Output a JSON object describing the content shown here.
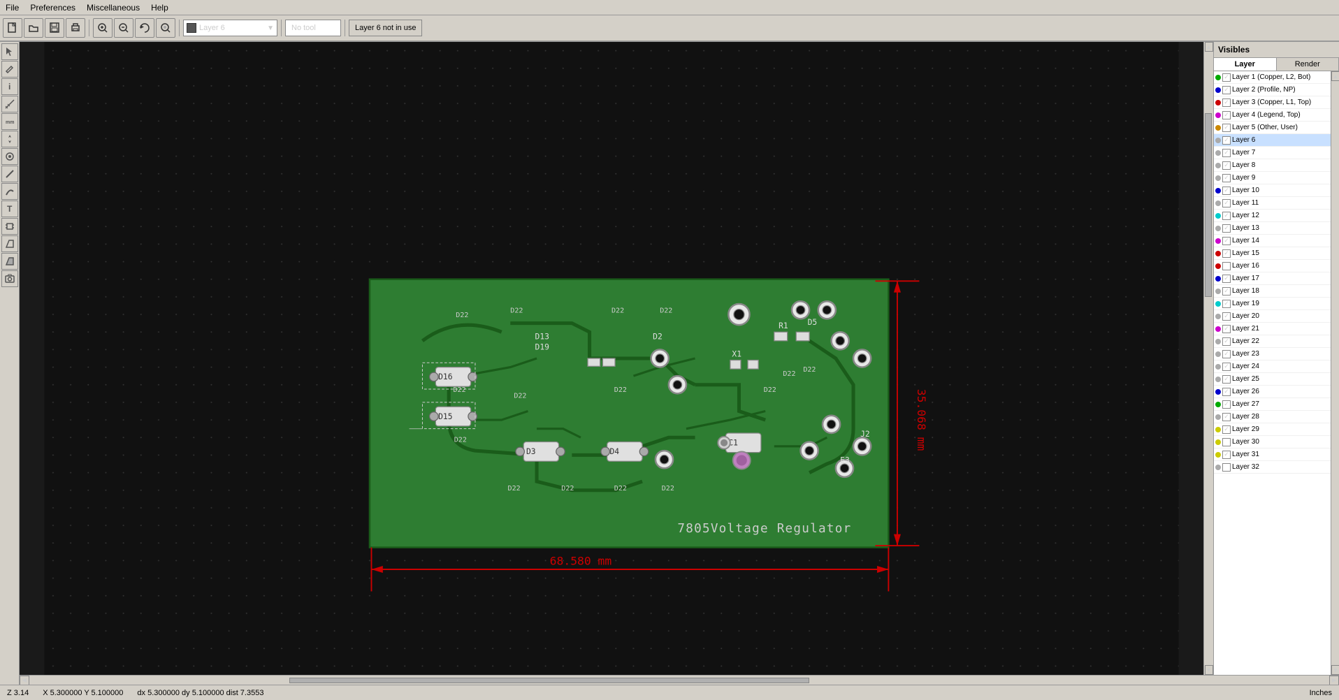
{
  "menu": {
    "items": [
      "File",
      "Preferences",
      "Miscellaneous",
      "Help"
    ]
  },
  "toolbar": {
    "layer_name": "Layer 6",
    "layer_color": "#555555",
    "tool_label": "No tool",
    "status_label": "Layer 6 not in use",
    "zoom_in_label": "🔍+",
    "zoom_out_label": "🔍-",
    "zoom_full_label": "⊡",
    "zoom_fit_label": "⊞"
  },
  "visibles": {
    "header": "Visibles",
    "tabs": [
      "Layer",
      "Render"
    ],
    "active_tab": "Layer"
  },
  "layers": [
    {
      "name": "Layer 1 (Copper, L2, Bot)",
      "dot_color": "#00aa00",
      "checked": true,
      "selected": false
    },
    {
      "name": "Layer 2 (Profile, NP)",
      "dot_color": "#0000cc",
      "checked": true,
      "selected": false
    },
    {
      "name": "Layer 3 (Copper, L1, Top)",
      "dot_color": "#cc0000",
      "checked": true,
      "selected": false
    },
    {
      "name": "Layer 4 (Legend, Top)",
      "dot_color": "#cc00cc",
      "checked": true,
      "selected": false
    },
    {
      "name": "Layer 5 (Other, User)",
      "dot_color": "#cc8800",
      "checked": true,
      "selected": false
    },
    {
      "name": "Layer 6",
      "dot_color": "#aaaaaa",
      "checked": true,
      "selected": true
    },
    {
      "name": "Layer 7",
      "dot_color": "#aaaaaa",
      "checked": true,
      "selected": false
    },
    {
      "name": "Layer 8",
      "dot_color": "#aaaaaa",
      "checked": true,
      "selected": false
    },
    {
      "name": "Layer 9",
      "dot_color": "#aaaaaa",
      "checked": true,
      "selected": false
    },
    {
      "name": "Layer 10",
      "dot_color": "#0000cc",
      "checked": true,
      "selected": false
    },
    {
      "name": "Layer 11",
      "dot_color": "#aaaaaa",
      "checked": true,
      "selected": false
    },
    {
      "name": "Layer 12",
      "dot_color": "#00cccc",
      "checked": true,
      "selected": false
    },
    {
      "name": "Layer 13",
      "dot_color": "#aaaaaa",
      "checked": true,
      "selected": false
    },
    {
      "name": "Layer 14",
      "dot_color": "#cc00cc",
      "checked": true,
      "selected": false
    },
    {
      "name": "Layer 15",
      "dot_color": "#cc0000",
      "checked": true,
      "selected": false
    },
    {
      "name": "Layer 16",
      "dot_color": "#cc0000",
      "checked": false,
      "selected": false
    },
    {
      "name": "Layer 17",
      "dot_color": "#0000cc",
      "checked": true,
      "selected": false
    },
    {
      "name": "Layer 18",
      "dot_color": "#aaaaaa",
      "checked": true,
      "selected": false
    },
    {
      "name": "Layer 19",
      "dot_color": "#00cccc",
      "checked": true,
      "selected": false
    },
    {
      "name": "Layer 20",
      "dot_color": "#aaaaaa",
      "checked": true,
      "selected": false
    },
    {
      "name": "Layer 21",
      "dot_color": "#cc00cc",
      "checked": true,
      "selected": false
    },
    {
      "name": "Layer 22",
      "dot_color": "#aaaaaa",
      "checked": true,
      "selected": false
    },
    {
      "name": "Layer 23",
      "dot_color": "#aaaaaa",
      "checked": true,
      "selected": false
    },
    {
      "name": "Layer 24",
      "dot_color": "#aaaaaa",
      "checked": true,
      "selected": false
    },
    {
      "name": "Layer 25",
      "dot_color": "#aaaaaa",
      "checked": true,
      "selected": false
    },
    {
      "name": "Layer 26",
      "dot_color": "#0000cc",
      "checked": true,
      "selected": false
    },
    {
      "name": "Layer 27",
      "dot_color": "#00aa00",
      "checked": true,
      "selected": false
    },
    {
      "name": "Layer 28",
      "dot_color": "#aaaaaa",
      "checked": true,
      "selected": false
    },
    {
      "name": "Layer 29",
      "dot_color": "#cccc00",
      "checked": true,
      "selected": false
    },
    {
      "name": "Layer 30",
      "dot_color": "#cccc00",
      "checked": false,
      "selected": false
    },
    {
      "name": "Layer 31",
      "dot_color": "#cccc00",
      "checked": true,
      "selected": false
    },
    {
      "name": "Layer 32",
      "dot_color": "#aaaaaa",
      "checked": false,
      "selected": false
    }
  ],
  "statusbar": {
    "z_label": "Z 3.14",
    "xy_label": "X 5.300000  Y 5.100000",
    "delta_label": "dx 5.300000  dy 5.100000  dist 7.3553",
    "units_label": "Inches"
  },
  "pcb": {
    "board_title": "7805Voltage Regulator",
    "dim_h": "68.580 mm",
    "dim_v": "35.068 mm"
  }
}
